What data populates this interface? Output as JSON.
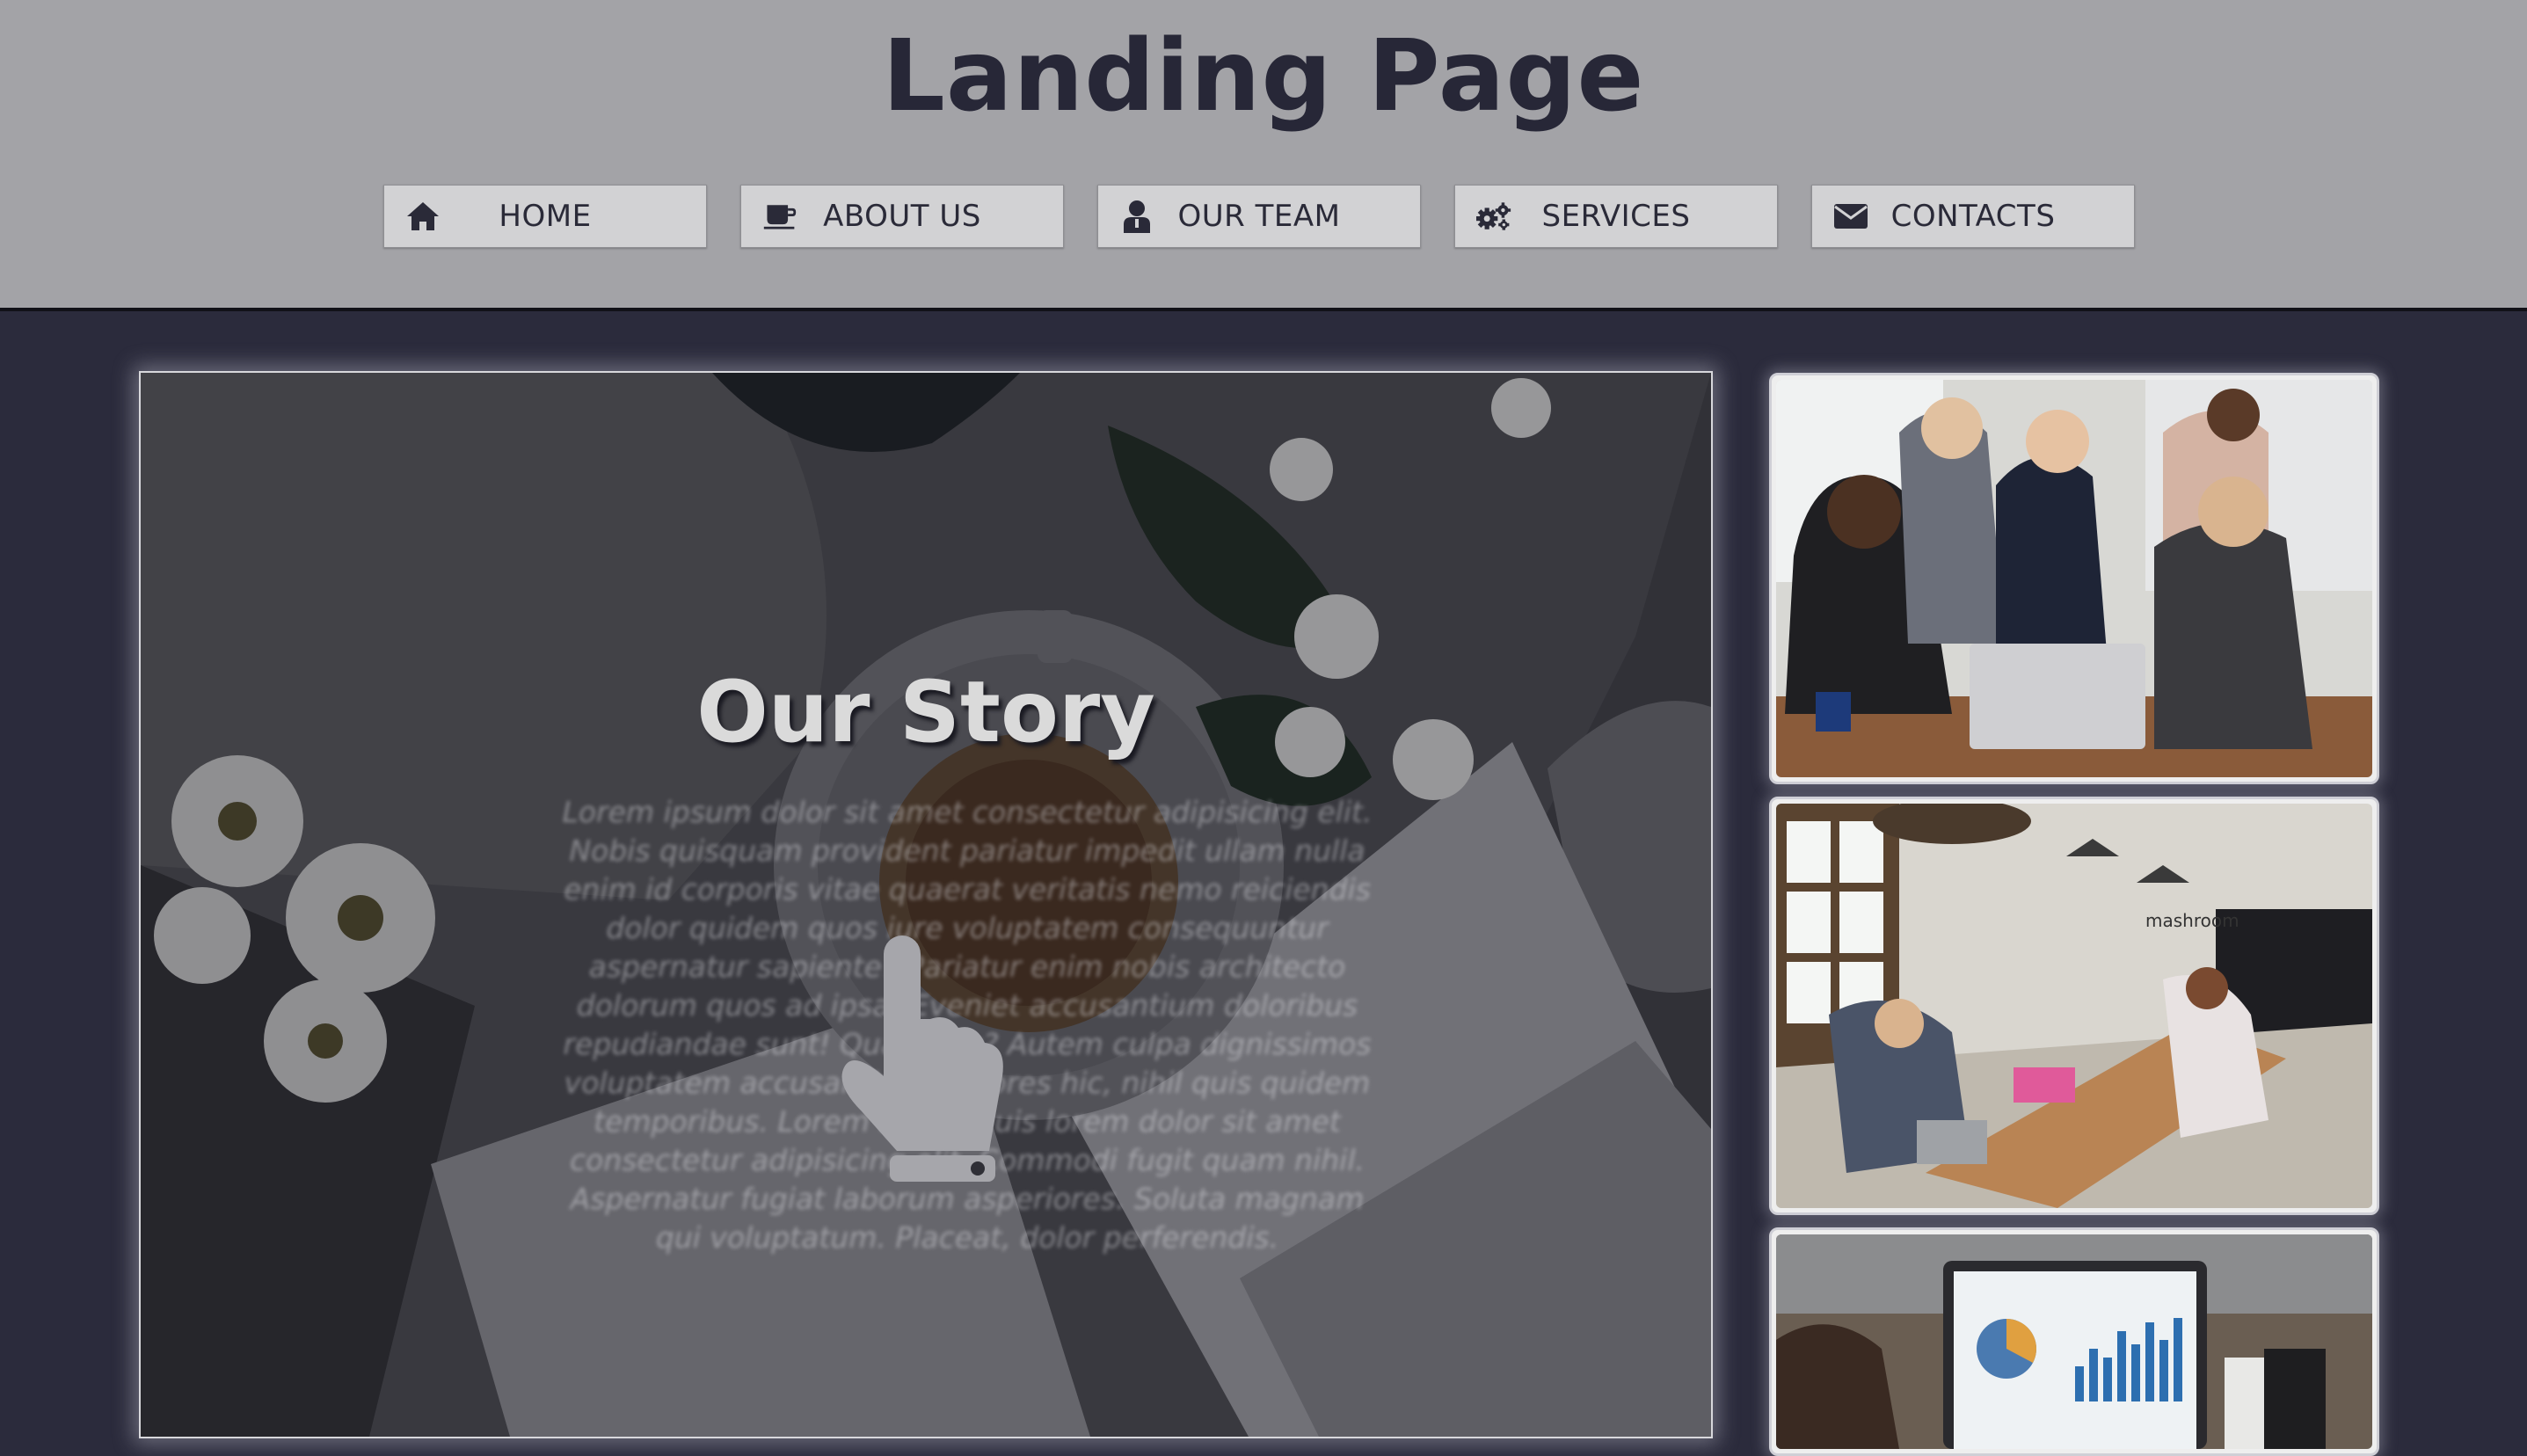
{
  "header": {
    "title": "Landing Page",
    "nav": [
      {
        "label": "HOME",
        "icon": "home-icon"
      },
      {
        "label": "ABOUT US",
        "icon": "coffee-icon"
      },
      {
        "label": "OUR TEAM",
        "icon": "user-icon"
      },
      {
        "label": "SERVICES",
        "icon": "gears-icon"
      },
      {
        "label": "CONTACTS",
        "icon": "envelope-icon"
      }
    ]
  },
  "hero": {
    "title": "Our Story",
    "text": "Lorem ipsum dolor sit amet consectetur adipisicing elit. Nobis quisquam provident pariatur impedit ullam nulla enim id corporis vitae quaerat veritatis nemo reiciendis dolor quidem quos iure voluptatem consequuntur aspernatur sapiente? Pariatur enim nobis architecto dolorum quos ad ipsa! Eveniet accusantium doloribus repudiandae sunt! Quas, eos? Autem culpa dignissimos voluptatem accusantium maiores hic, nihil quis quidem temporibus. Lorem ipsum quis lorem dolor sit amet consectetur adipisicing elit. Commodi fugit quam nihil. Aspernatur fugiat laborum asperiores. Soluta magnam qui voluptatum. Placeat, dolor perferendis.",
    "pointer_icon": "hand-pointer-icon"
  },
  "gallery": {
    "images": [
      "team-meeting-photo",
      "office-workspace-photo",
      "laptop-chart-photo"
    ],
    "sign_text": "mashroom"
  },
  "colors": {
    "header_bg": "#a3a3a7",
    "page_bg": "#2b2b3c",
    "nav_bg": "#d2d2d4",
    "title_color": "#272737"
  }
}
